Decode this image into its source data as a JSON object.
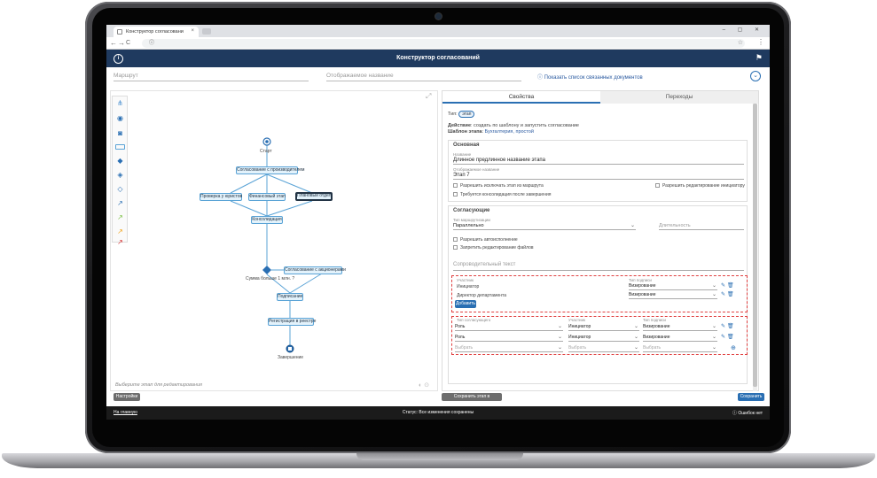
{
  "browser": {
    "tab_title": "Конструктор согласовани",
    "tab_close": "×",
    "address": "",
    "window_controls": "– ▢ ✕",
    "nav": [
      "←",
      "→",
      "C",
      "ⓘ"
    ],
    "star": "☆",
    "menu": "⋮"
  },
  "app": {
    "logo": "i",
    "title": "Конструктор согласований",
    "flag_icon": "flag-icon"
  },
  "route_row": {
    "route_placeholder": "Маршрут",
    "display_name_placeholder": "Отображаемое название",
    "linked_docs": "ⓘ Показать список связанных документов",
    "collapse_icon": "⌄"
  },
  "diagram": {
    "nodes": {
      "start": "Старт",
      "approval_producer": "Согласование с производителем",
      "legal_check": "Проверка у юристов",
      "finance_stage": "Финансовый этап",
      "planning_dept": "Плановый отдел",
      "consolidation": "Консолидация",
      "sum_condition": "Сумма больше 1 млн. ?",
      "shareholders": "Согласование с акционерами",
      "signing": "Подписание",
      "registry": "Регистрация в реестре",
      "finish": "Завершение"
    },
    "hint": "Выберите этап для редактирования"
  },
  "props": {
    "tabs": [
      "Свойства",
      "Переходы"
    ],
    "type_label": "Тип",
    "type_value": "этап",
    "action_label": "Действие",
    "action_value": ": создать по шаблону и запустить согласование",
    "template_label": "Шаблон этапа",
    "template_value": "Бухгалтерия, простой",
    "main_section": {
      "title": "Основная",
      "name_label": "Название",
      "name_value": "Длинное предлинное название этапа",
      "display_label": "Отображаемое название",
      "display_value": "Этап 7",
      "cb_exclude": "Разрешить исключать этап из маршрута",
      "cb_edit": "Разрешить редактирование инициатору",
      "cb_consolidate": "Требуется консолидация после завершения"
    },
    "approvers_section": {
      "title": "Согласующие",
      "type_label": "Тип маршрутизации",
      "type_value": "Параллельно",
      "duration": "Длительность",
      "cb_auto": "Разрешить автоисполнение",
      "cb_nofiles": "Запретить редактирование файлов",
      "cover_text": "Сопроводительный текст"
    },
    "table1": {
      "headers": [
        "Участник",
        "Тип подписи"
      ],
      "rows": [
        [
          "Инициатор",
          "Визирование"
        ],
        [
          "Директор департамента",
          "Визирование"
        ]
      ],
      "add_button": "Добавить"
    },
    "table2": {
      "headers": [
        "Тип согласующего",
        "Участник",
        "Тип подписи"
      ],
      "rows": [
        [
          "Роль",
          "Инициатор",
          "Визирование"
        ],
        [
          "Роль",
          "Инициатор",
          "Визирование"
        ]
      ],
      "placeholder": "Выбрать"
    }
  },
  "actions": {
    "settings": "Настройки",
    "save_to_library": "Сохранить этап в библиотеку",
    "save": "Сохранить"
  },
  "status": {
    "left": "На главную",
    "center": "Статус: Все изменения сохранены",
    "right": "Ошибок нет"
  },
  "colors": {
    "header": "#1f3a5f",
    "accent": "#2a6fb3",
    "node_fill": "#e3f2fb",
    "error_border": "#e04040"
  }
}
